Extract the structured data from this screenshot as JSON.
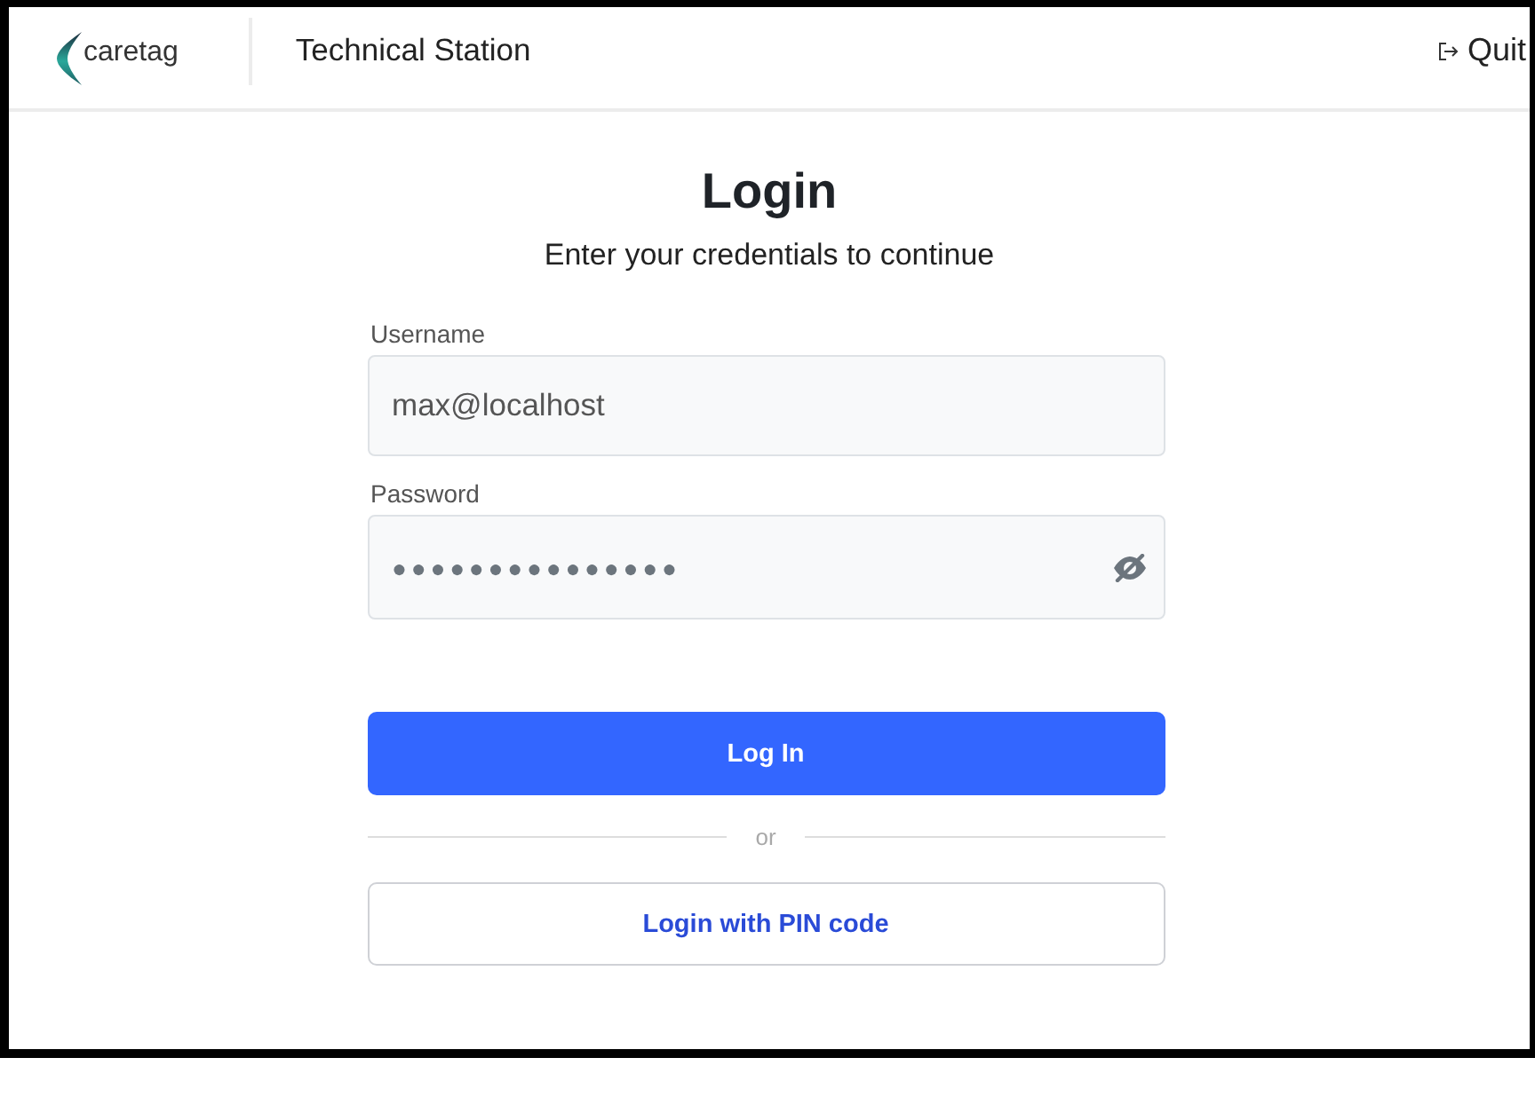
{
  "header": {
    "logo": {
      "text": "caretag"
    },
    "title": "Technical Station",
    "quit_button": {
      "label": "Quit"
    }
  },
  "login": {
    "title": "Login",
    "subtitle": "Enter your credentials to continue",
    "fields": [
      {
        "kind": "text",
        "label": "Username",
        "value": "max@localhost"
      },
      {
        "kind": "password",
        "label": "Password",
        "value": "●●●●●●●●●●●●●●●"
      }
    ],
    "primary_button": "Log In",
    "divider": "or",
    "secondary_button": "Login with PIN code"
  }
}
